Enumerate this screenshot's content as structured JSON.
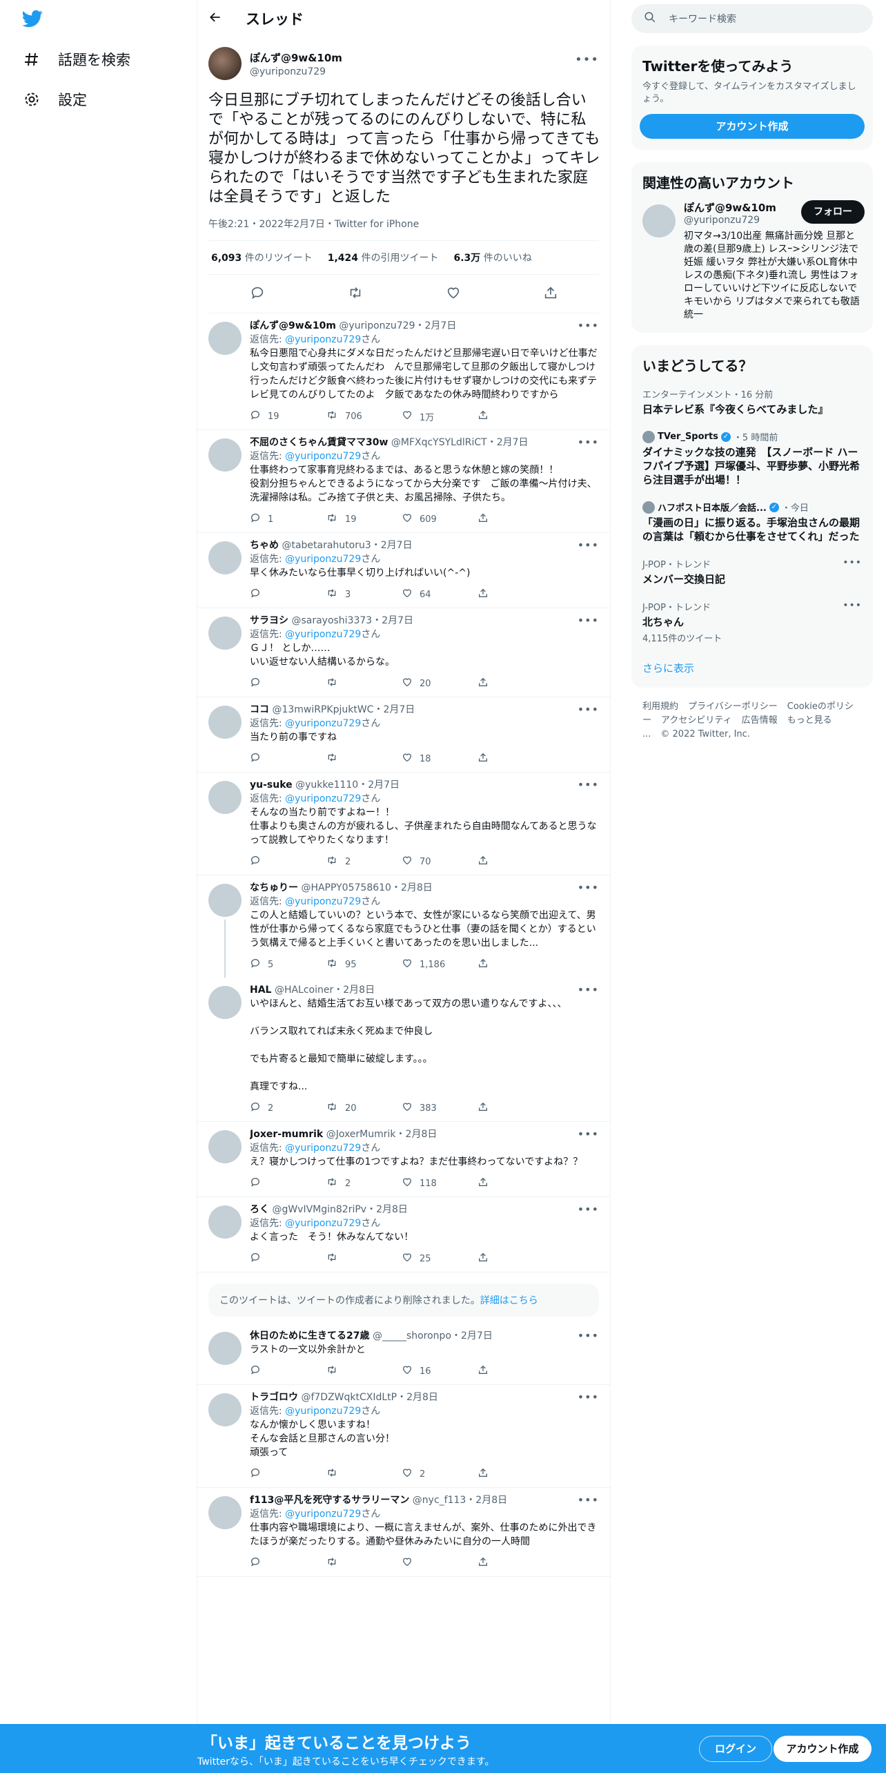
{
  "nav": {
    "explore_label": "話題を検索",
    "settings_label": "設定"
  },
  "header": {
    "title": "スレッド"
  },
  "main_tweet": {
    "name": "ぽんず@9w&10m",
    "handle": "@yuriponzu729",
    "text": "今日旦那にブチ切れてしまったんだけどその後話し合いで「やることが残ってるのにのんびりしないで、特に私が何かしてる時は」って言ったら「仕事から帰ってきても寝かしつけが終わるまで休めないってことかよ」ってキレられたので「はいそうです当然です子ども生まれた家庭は全員そうです」と返した",
    "meta": "午後2:21・2022年2月7日・Twitter for iPhone",
    "retweets": "6,093",
    "retweets_label": "件のリツイート",
    "quotes": "1,424",
    "quotes_label": "件の引用ツイート",
    "likes": "6.3万",
    "likes_label": "件のいいね"
  },
  "replying_to_prefix": "返信先: ",
  "replying_to_suffix": "さん",
  "replies": [
    {
      "name": "ぽんず@9w&10m",
      "handle": "@yuriponzu729",
      "date": "・2月7日",
      "reply_to": "@yuriponzu729",
      "text": "私今日悪阻で心身共にダメな日だったんだけど旦那帰宅遅い日で辛いけど仕事だし文句言わず頑張ってたんだわ　んで旦那帰宅して旦那の夕飯出して寝かしつけ行ったんだけど夕飯食べ終わった後に片付けもせず寝かしつけの交代にも来ずテレビ見てのんびりしてたのよ　夕飯であなたの休み時間終わりですから",
      "replies": "19",
      "retweets": "706",
      "likes": "1万"
    },
    {
      "name": "不屈のさくちゃん賃貸ママ30w",
      "handle": "@MFXqcYSYLdlRiCT",
      "date": "・2月7日",
      "reply_to": "@yuriponzu729",
      "text": "仕事終わって家事育児終わるまでは、あると思うな休憩と嫁の笑顔！！\n役割分担ちゃんとできるようになってから大分楽です　ご飯の準備〜片付け夫、洗濯掃除は私。ごみ捨て子供と夫、お風呂掃除、子供たち。",
      "replies": "1",
      "retweets": "19",
      "likes": "609"
    },
    {
      "name": "ちゃめ",
      "handle": "@tabetarahutoru3",
      "date": "・2月7日",
      "reply_to": "@yuriponzu729",
      "text": "早く休みたいなら仕事早く切り上げればいい(^-^)",
      "replies": "",
      "retweets": "3",
      "likes": "64"
    },
    {
      "name": "サラヨシ",
      "handle": "@sarayoshi3373",
      "date": "・2月7日",
      "reply_to": "@yuriponzu729",
      "text": "ＧＪ！ としか……\nいい返せない人結構いるからな。",
      "replies": "",
      "retweets": "",
      "likes": "20"
    },
    {
      "name": "ココ",
      "handle": "@13mwiRPKpjuktWC",
      "date": "・2月7日",
      "reply_to": "@yuriponzu729",
      "text": "当たり前の事ですね",
      "replies": "",
      "retweets": "",
      "likes": "18"
    },
    {
      "name": "yu-suke",
      "handle": "@yukke1110",
      "date": "・2月7日",
      "reply_to": "@yuriponzu729",
      "text": "そんなの当たり前ですよねー！！\n仕事よりも奥さんの方が疲れるし、子供産まれたら自由時間なんてあると思うなって説教してやりたくなります！",
      "replies": "",
      "retweets": "2",
      "likes": "70"
    },
    {
      "name": "なちゅりー",
      "handle": "@HAPPY05758610",
      "date": "・2月8日",
      "reply_to": "@yuriponzu729",
      "text": "この人と結婚していいの？という本で、女性が家にいるなら笑顔で出迎えて、男性が仕事から帰ってくるなら家庭でもうひと仕事（妻の話を聞くとか）するという気構えで帰ると上手くいくと書いてあったのを思い出しました...",
      "replies": "5",
      "retweets": "95",
      "likes": "1,186",
      "thread": true
    },
    {
      "name": "HAL",
      "handle": "@HALcoiner",
      "date": "・2月8日",
      "reply_to": "",
      "text": "いやほんと、結婚生活てお互い様であって双方の思い遣りなんですよ、、、\n\nバランス取れてれば末永く死ぬまで仲良し\n\nでも片寄ると最知で簡単に破綻します。。。\n\n真理ですね...",
      "replies": "2",
      "retweets": "20",
      "likes": "383"
    },
    {
      "name": "Joxer-mumrik",
      "handle": "@JoxerMumrik",
      "date": "・2月8日",
      "reply_to": "@yuriponzu729",
      "text": "え？寝かしつけって仕事の1つですよね？まだ仕事終わってないですよね？？",
      "replies": "",
      "retweets": "2",
      "likes": "118"
    },
    {
      "name": "ろく",
      "handle": "@gWvIVMgin82riPv",
      "date": "・2月8日",
      "reply_to": "@yuriponzu729",
      "text": "よく言った　そう！休みなんてない！",
      "replies": "",
      "retweets": "",
      "likes": "25"
    }
  ],
  "deleted_notice": {
    "text": "このツイートは、ツイートの作成者により削除されました。",
    "link": "詳細はこちら"
  },
  "replies2": [
    {
      "name": "休日のために生きてる27歳",
      "handle": "@_____shoronpo",
      "date": "・2月7日",
      "reply_to": "",
      "text": "ラストの一文以外余計かと",
      "replies": "",
      "retweets": "",
      "likes": "16"
    },
    {
      "name": "トラゴロウ",
      "handle": "@f7DZWqktCXIdLtP",
      "date": "・2月8日",
      "reply_to": "@yuriponzu729",
      "text": "なんか懐かしく思いますね！\nそんな会話と旦那さんの言い分！\n頑張って",
      "replies": "",
      "retweets": "",
      "likes": "2"
    },
    {
      "name": "f113@平凡を死守するサラリーマン",
      "handle": "@nyc_f113",
      "date": "・2月8日",
      "reply_to": "@yuriponzu729",
      "text": "仕事内容や職場環境により、一概に言えませんが、案外、仕事のために外出できたほうが楽だったりする。通勤や昼休みみたいに自分の一人時間",
      "replies": "",
      "retweets": "",
      "likes": ""
    }
  ],
  "sidebar": {
    "search_placeholder": "キーワード検索",
    "join": {
      "title": "Twitterを使ってみよう",
      "subtitle": "今すぐ登録して、タイムラインをカスタマイズしましょう。",
      "button": "アカウント作成"
    },
    "relevant": {
      "title": "関連性の高いアカウント",
      "name": "ぽんず@9w&10m",
      "handle": "@yuriponzu729",
      "bio": "初マタ→3/10出産 無痛計画分娩 旦那と歳の差(旦那9歳上) レスｰ>シリンジ法で妊娠 緩いヲタ 弊社が大嫌い系OL育休中 レスの愚痴(下ネタ)垂れ流し 男性はフォローしていいけど下ツイに反応しないでキモいから リプはタメで来られても敬語統一",
      "follow": "フォロー"
    },
    "trends": {
      "title": "いまどうしてる？",
      "items": [
        {
          "meta": "エンターテインメント・16 分前",
          "title": "日本テレビ系『今夜くらべてみました』",
          "count": "",
          "source": ""
        },
        {
          "meta": "・5 時間前",
          "source": "TVer_Sports",
          "title": "ダイナミックな技の連発　【スノーボード ハーフパイプ予選】戸塚優斗、平野歩夢、小野光希ら注目選手が出場！！",
          "count": ""
        },
        {
          "meta": "・今日",
          "source": "ハフポスト日本版／会話...",
          "title": "「漫画の日」に振り返る。手塚治虫さんの最期の言葉は「頼むから仕事をさせてくれ」だった",
          "count": ""
        },
        {
          "meta": "J-POP・トレンド",
          "source": "",
          "title": "メンバー交換日記",
          "count": ""
        },
        {
          "meta": "J-POP・トレンド",
          "source": "",
          "title": "北ちゃん",
          "count": "4,115件のツイート"
        }
      ],
      "show_more": "さらに表示"
    },
    "footer": [
      "利用規約",
      "プライバシーポリシー",
      "Cookieのポリシー",
      "アクセシビリティ",
      "広告情報",
      "もっと見る ...",
      "© 2022 Twitter, Inc."
    ]
  },
  "bottom_bar": {
    "title": "「いま」起きていることを見つけよう",
    "subtitle": "Twitterなら、「いま」起きていることをいち早くチェックできます。",
    "login": "ログイン",
    "signup": "アカウント作成"
  },
  "colors": {
    "accent": "#1d9bf0",
    "text": "#0f1419",
    "secondary": "#536471"
  }
}
